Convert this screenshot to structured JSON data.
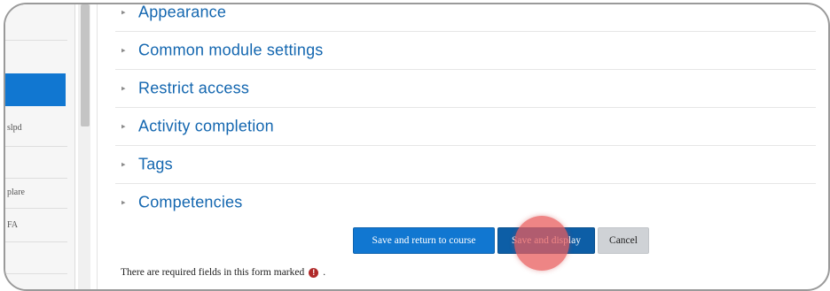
{
  "sidebar": {
    "items": [
      {
        "label": "slpd"
      },
      {
        "label": "plare"
      },
      {
        "label": "FA"
      }
    ]
  },
  "sections": [
    {
      "label": "Appearance"
    },
    {
      "label": "Common module settings"
    },
    {
      "label": "Restrict access"
    },
    {
      "label": "Activity completion"
    },
    {
      "label": "Tags"
    },
    {
      "label": "Competencies"
    }
  ],
  "buttons": {
    "save_return": "Save and return to course",
    "save_display": "Save and display",
    "cancel": "Cancel"
  },
  "footer": {
    "required_text": "There are required fields in this form marked",
    "required_icon": "!",
    "trailing": "."
  },
  "icons": {
    "section_arrow": "▸",
    "required_icon_name": "required-exclamation-icon"
  },
  "colors": {
    "primary": "#1177d1",
    "link": "#1467b0",
    "cursor_highlight": "#e85c5c",
    "required": "#b02a2a"
  }
}
